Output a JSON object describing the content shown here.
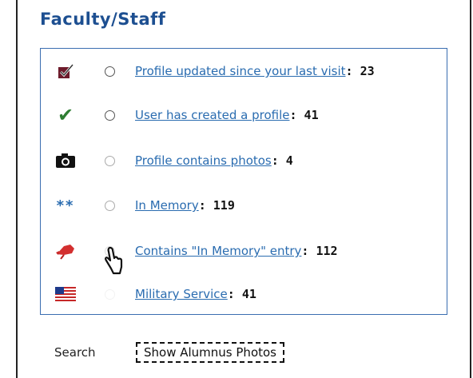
{
  "header": {
    "title": "Faculty/Staff"
  },
  "legend": {
    "items": [
      {
        "icon": "checked-box-icon",
        "link": "Profile updated since your last visit",
        "count": ": 23"
      },
      {
        "icon": "checkmark-icon",
        "link": "User has created a profile",
        "count": ": 41"
      },
      {
        "icon": "camera-icon",
        "link": "Profile contains photos",
        "count": ": 4"
      },
      {
        "icon": "double-star-icon",
        "stars": "**",
        "link": "In Memory",
        "count": ": 119"
      },
      {
        "icon": "rose-icon",
        "link": "Contains \"In Memory\" entry",
        "count": ": 112"
      },
      {
        "icon": "us-flag-icon",
        "link": "Military Service",
        "count": ": 41"
      }
    ]
  },
  "footer": {
    "search_label": "Search",
    "photos_button": "Show Alumnus Photos"
  },
  "colors": {
    "title": "#1d4f91",
    "link": "#2a6cb0",
    "panel_border": "#3a6db0",
    "checkmark": "#2e7d32",
    "rose": "#d32f2f",
    "checkbox": "#6d1b2b"
  }
}
